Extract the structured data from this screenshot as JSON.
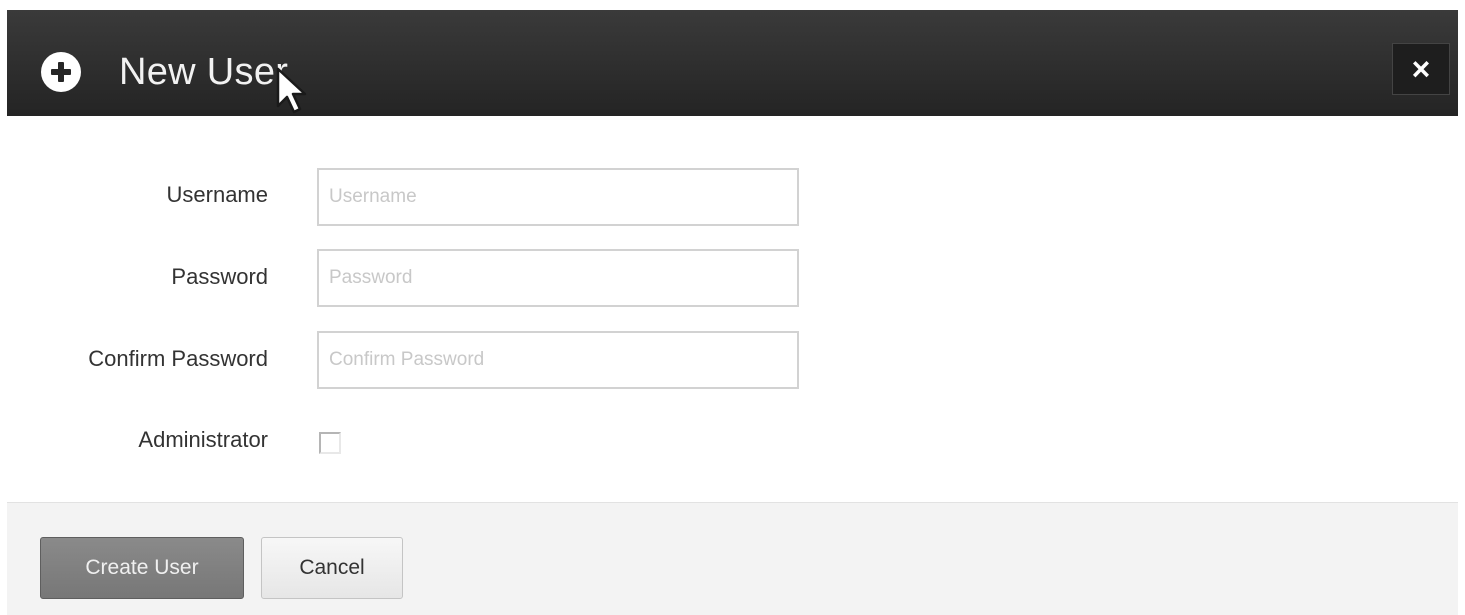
{
  "dialog": {
    "title": "New User",
    "title_icon": "plus-circle-icon",
    "close_label": "×",
    "close_icon": "close-icon"
  },
  "form": {
    "username": {
      "label": "Username",
      "placeholder": "Username",
      "value": ""
    },
    "password": {
      "label": "Password",
      "placeholder": "Password",
      "value": ""
    },
    "confirm_password": {
      "label": "Confirm Password",
      "placeholder": "Confirm Password",
      "value": ""
    },
    "administrator": {
      "label": "Administrator",
      "checked": false
    }
  },
  "footer": {
    "create_label": "Create User",
    "cancel_label": "Cancel"
  },
  "colors": {
    "titlebar": "#2e2e2e",
    "primary_button": "#7f7f7f",
    "footer_bg": "#f3f3f3"
  }
}
